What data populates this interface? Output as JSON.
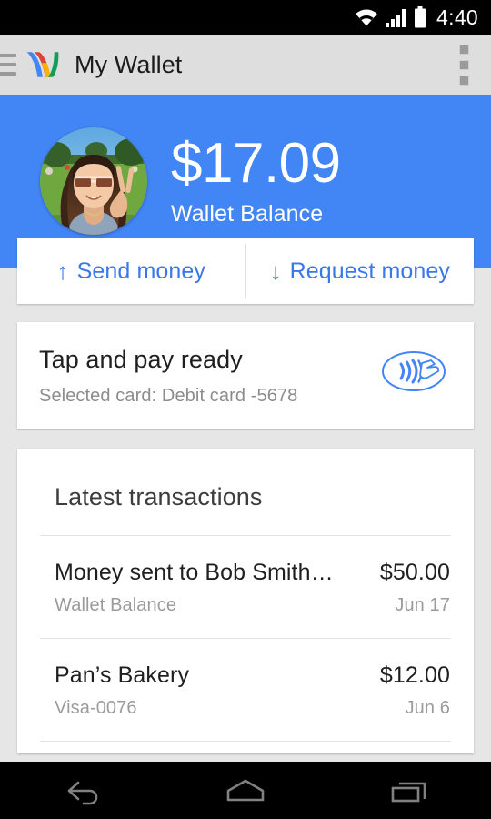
{
  "statusbar": {
    "time": "4:40",
    "icons": [
      "wifi-icon",
      "cellular-signal-icon",
      "battery-icon"
    ]
  },
  "appbar": {
    "menu_icon": "hamburger-menu-icon",
    "logo": "google-wallet-logo",
    "title": "My Wallet",
    "overflow_icon": "overflow-menu-icon"
  },
  "hero": {
    "avatar": "user-profile-photo",
    "balance": "$17.09",
    "balance_label": "Wallet Balance",
    "background_color": "#4285f4"
  },
  "actions": [
    {
      "label": "Send money",
      "arrow": "↑",
      "icon": "arrow-up-icon"
    },
    {
      "label": "Request money",
      "arrow": "↓",
      "icon": "arrow-down-icon"
    }
  ],
  "tap_and_pay": {
    "title": "Tap and pay ready",
    "subtitle": "Selected card: Debit card -5678",
    "icon": "contactless-payment-icon",
    "icon_color": "#4285f4"
  },
  "transactions": {
    "heading": "Latest transactions",
    "rows": [
      {
        "name": "Money sent to Bob Smith…",
        "source": "Wallet Balance",
        "amount": "$50.00",
        "date": "Jun 17"
      },
      {
        "name": "Pan’s Bakery",
        "source": "Visa-0076",
        "amount": "$12.00",
        "date": "Jun 6"
      }
    ]
  },
  "navbar": {
    "buttons": [
      {
        "name": "back-button",
        "icon": "back-arrow-icon"
      },
      {
        "name": "home-button",
        "icon": "home-icon"
      },
      {
        "name": "recents-button",
        "icon": "recent-apps-icon"
      }
    ]
  },
  "colors": {
    "accent": "#4285f4",
    "link": "#3b78e7",
    "background": "#e6e6e6",
    "card": "#ffffff",
    "appbar": "#dedede"
  }
}
